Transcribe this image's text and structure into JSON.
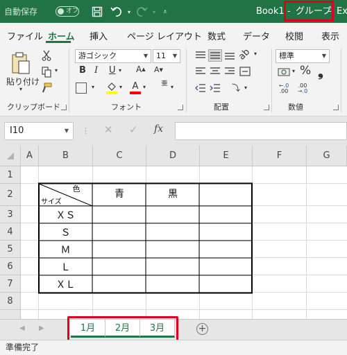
{
  "titlebar": {
    "autosave_label": "自動保存",
    "autosave_state": "オフ",
    "title_book": "Book1",
    "title_sep": "-",
    "title_group": "グループ",
    "title_app": "Exc"
  },
  "ribbon_tabs": [
    "ファイル",
    "ホーム",
    "挿入",
    "ページ レイアウト",
    "数式",
    "データ",
    "校閲",
    "表示"
  ],
  "ribbon": {
    "paste_label": "貼り付け",
    "font_name": "游ゴシック",
    "font_size": "11",
    "bold": "B",
    "italic": "I",
    "underline": "U",
    "number_format": "標準",
    "percent": "%",
    "groups": {
      "clipboard": "クリップボード",
      "font": "フォント",
      "alignment": "配置",
      "number": "数値"
    },
    "colors": {
      "highlight": "#ffff00",
      "font_color": "#ff0000",
      "accent": "#217346"
    }
  },
  "formula_bar": {
    "name_box": "I10",
    "fx": "fx"
  },
  "grid": {
    "columns": [
      "A",
      "B",
      "C",
      "D",
      "E",
      "F",
      "G"
    ],
    "rows": [
      "1",
      "2",
      "3",
      "4",
      "5",
      "6",
      "7",
      "8"
    ],
    "header_top_right": "色",
    "header_bottom_left": "サイズ",
    "color_headers": [
      "青",
      "黒",
      ""
    ],
    "sizes": [
      "ＸＳ",
      "Ｓ",
      "Ｍ",
      "Ｌ",
      "ＸＬ"
    ]
  },
  "sheets": [
    "1月",
    "2月",
    "3月"
  ],
  "status": "準備完了",
  "icons": [
    "save-icon",
    "undo-icon",
    "redo-icon",
    "customize-qat-icon",
    "paste-icon",
    "cut-icon",
    "copy-icon",
    "format-painter-icon",
    "add-sheet-icon"
  ]
}
